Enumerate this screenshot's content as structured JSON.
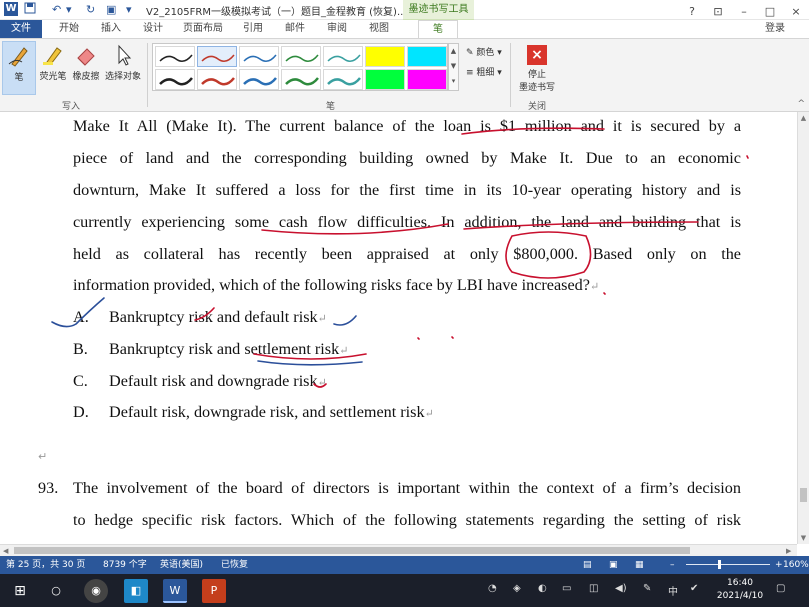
{
  "titlebar": {
    "app_icon": "W",
    "doc_title": "V2_2105FRM一级模拟考试（一）题目_金程教育 (恢复)...",
    "context_tab_title": "墨迹书写工具",
    "help": "?",
    "minimize": "–",
    "restore": "□",
    "close": "×"
  },
  "tabs": {
    "file": "文件",
    "items": [
      "开始",
      "插入",
      "设计",
      "页面布局",
      "引用",
      "邮件",
      "审阅",
      "视图",
      "笔"
    ],
    "login": "登录"
  },
  "ribbon": {
    "pen": "笔",
    "highlighter": "荧光笔",
    "eraser": "橡皮擦",
    "select": "选择对象",
    "group_write": "写入",
    "group_pens": "笔",
    "color": "颜色",
    "weight": "粗细",
    "stop_line1": "停止",
    "stop_line2": "墨迹书写",
    "group_close": "关闭",
    "stop_icon": "×",
    "pen_swatch_colors": [
      "#222222",
      "#c0392b",
      "#2a6fb5",
      "#2e8b3d",
      "#3aa0a0",
      "#ffff00",
      "#00e5ff",
      "#222222",
      "#c0392b",
      "#2a6fb5",
      "#2e8b3d",
      "#3aa0a0",
      "#00ff3c",
      "#ff00ff"
    ]
  },
  "document": {
    "lines": [
      "Make It All (Make It). The current balance of the loan is $1 million and it is secured by a",
      "piece of land and the corresponding building owned by Make It. Due to an economic",
      "downturn, Make It suffered a loss for the first time in its 10-year operating history and is",
      "currently experiencing some cash flow difficulties. In addition, the land and building that is",
      "held as collateral has recently been appraised at only $800,000. Based only on the",
      "information provided, which of the following risks face by LBI have increased?"
    ],
    "para_mark": "↵",
    "options": [
      {
        "letter": "A.",
        "text": "Bankruptcy risk and default risk"
      },
      {
        "letter": "B.",
        "text": "Bankruptcy risk and settlement risk"
      },
      {
        "letter": "C.",
        "text": "Default risk and downgrade risk"
      },
      {
        "letter": "D.",
        "text": "Default risk, downgrade risk, and settlement risk"
      }
    ],
    "q93_number": "93.",
    "q93_lines": [
      "The involvement of the board of directors is important within the context of a firm’s decision",
      "to hedge specific risk factors. Which of the following statements regarding the setting of risk"
    ]
  },
  "statusbar": {
    "page": "第 25 页，共 30 页",
    "words": "8739 个字",
    "language": "英语(美国)",
    "recovered": "已恢复",
    "zoom": "160%",
    "zoom_minus": "–",
    "zoom_plus": "+"
  },
  "taskbar": {
    "time": "16:40",
    "date": "2021/4/10",
    "ime": "中",
    "word": "W",
    "ppt": "P"
  },
  "colors": {
    "word_blue": "#2b579a",
    "ink_red": "#c8102e",
    "ink_blue": "#2b4f9a"
  }
}
